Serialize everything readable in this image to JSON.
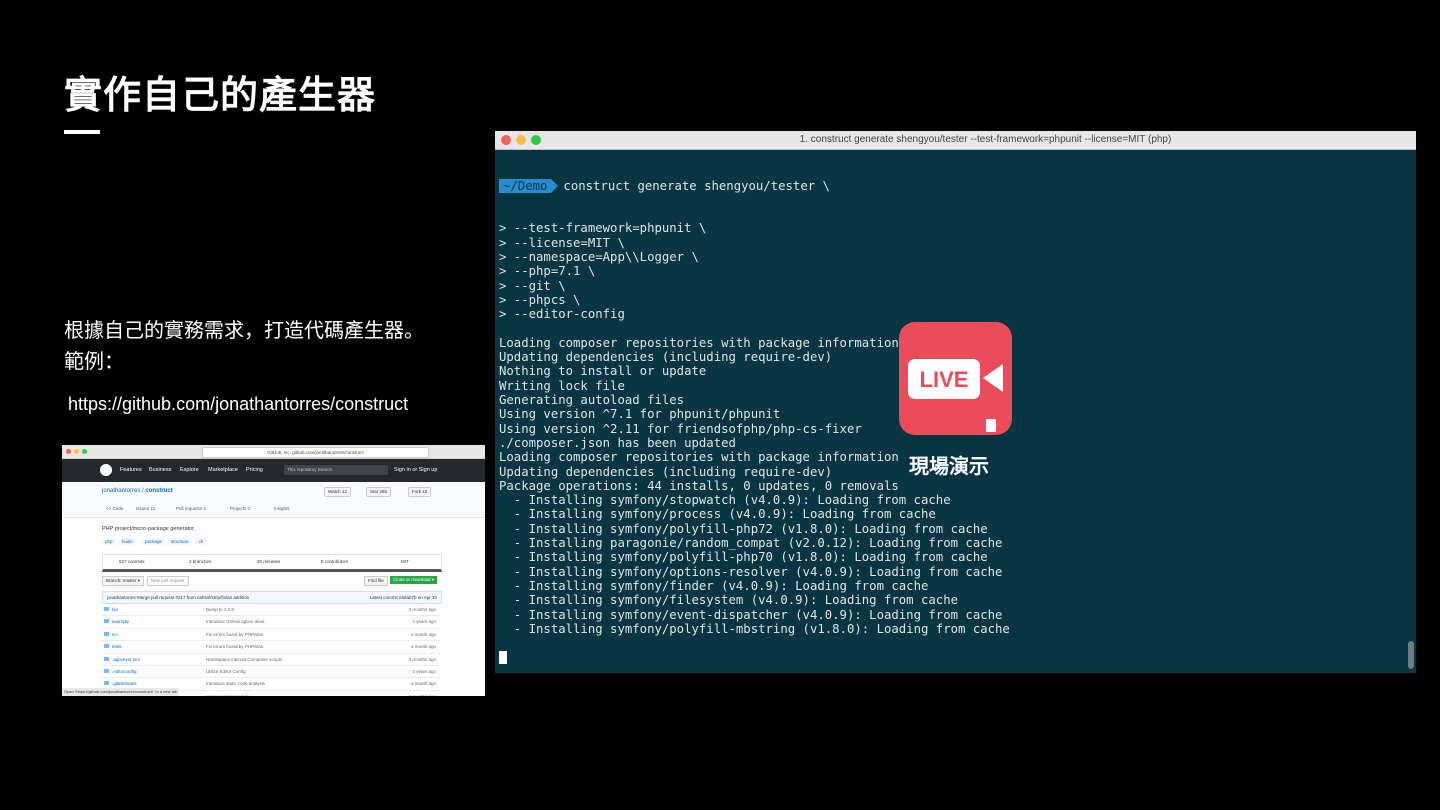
{
  "slide": {
    "title": "實作自己的產生器",
    "description_line1": "根據自己的實務需求，打造代碼產生器。",
    "description_line2": "範例：",
    "url": "https://github.com/jonathantorres/construct"
  },
  "github_screenshot": {
    "address": "GitHub, Inc. github.com/jonathantorres/construct",
    "nav": [
      "Features",
      "Business",
      "Explore",
      "Marketplace",
      "Pricing"
    ],
    "search_scope": "This repository",
    "search_placeholder": "Search",
    "signin": "Sign in or Sign up",
    "repo_owner": "jonathantorres",
    "repo_name": "construct",
    "watch": "Watch",
    "watch_count": "12",
    "star": "Star",
    "star_count": "265",
    "fork": "Fork",
    "fork_count": "15",
    "tabs": [
      "<> Code",
      "Issues 12",
      "Pull requests 4",
      "Projects 0",
      "Insights"
    ],
    "description": "PHP project/micro-package generator.",
    "topics": [
      "php",
      "boiler",
      "package",
      "structure",
      "cli"
    ],
    "stats": [
      "627 commits",
      "2 branches",
      "30 releases",
      "8 contributors",
      "MIT"
    ],
    "branch": "Branch: master ▾",
    "new_pr": "New pull request",
    "find_file": "Find file",
    "clone": "Clone or download ▾",
    "commit_msg": "jonathantorres Merge pull request #217 from nahsol/strip/fix/an addition",
    "commit_meta": "Latest commit ea5ab7b on Apr 10",
    "files": [
      {
        "name": "bin",
        "msg": "Bump to 2.0.0",
        "time": "3 months ago"
      },
      {
        "name": "example",
        "msg": "Introduce GitHub option alias.",
        "time": "2 years ago"
      },
      {
        "name": "src",
        "msg": "Fix errors found by PHPStan.",
        "time": "a month ago"
      },
      {
        "name": "tests",
        "msg": "Fix errors found by PHPStan.",
        "time": "a month ago"
      },
      {
        "name": ".appveyor.yml",
        "msg": "Namespace internal Composer scripts",
        "time": "3 months ago"
      },
      {
        "name": ".editorconfig",
        "msg": "Utilize Editor Config.",
        "time": "2 years ago"
      },
      {
        "name": ".gitattributes",
        "msg": "Introduce static code analysis.",
        "time": "a month ago"
      },
      {
        "name": ".gitignore",
        "msg": "Ignore composer.lock",
        "time": "4 months ago"
      }
    ],
    "status": "Open \"https://github.com/jonathantorres/construct/\" in a new tab"
  },
  "terminal": {
    "title": "1. construct generate shengyou/tester --test-framework=phpunit --license=MIT     (php)",
    "prompt_dir": "~/Demo",
    "prompt_cmd": "construct generate shengyou/tester \\",
    "lines": [
      "> --test-framework=phpunit \\",
      "> --license=MIT \\",
      "> --namespace=App\\\\Logger \\",
      "> --php=7.1 \\",
      "> --git \\",
      "> --phpcs \\",
      "> --editor-config",
      "",
      "Loading composer repositories with package information",
      "Updating dependencies (including require-dev)",
      "Nothing to install or update",
      "Writing lock file",
      "Generating autoload files",
      "Using version ^7.1 for phpunit/phpunit",
      "Using version ^2.11 for friendsofphp/php-cs-fixer",
      "./composer.json has been updated",
      "Loading composer repositories with package information",
      "Updating dependencies (including require-dev)",
      "Package operations: 44 installs, 0 updates, 0 removals",
      "  - Installing symfony/stopwatch (v4.0.9): Loading from cache",
      "  - Installing symfony/process (v4.0.9): Loading from cache",
      "  - Installing symfony/polyfill-php72 (v1.8.0): Loading from cache",
      "  - Installing paragonie/random_compat (v2.0.12): Loading from cache",
      "  - Installing symfony/polyfill-php70 (v1.8.0): Loading from cache",
      "  - Installing symfony/options-resolver (v4.0.9): Loading from cache",
      "  - Installing symfony/finder (v4.0.9): Loading from cache",
      "  - Installing symfony/filesystem (v4.0.9): Loading from cache",
      "  - Installing symfony/event-dispatcher (v4.0.9): Loading from cache",
      "  - Installing symfony/polyfill-mbstring (v1.8.0): Loading from cache"
    ]
  },
  "live_badge": {
    "logo_text": "LIVE",
    "label": "現場演示",
    "color": "#ea4c5b"
  },
  "colors": {
    "terminal_bg": "#073642",
    "prompt_bg": "#268bd2"
  }
}
